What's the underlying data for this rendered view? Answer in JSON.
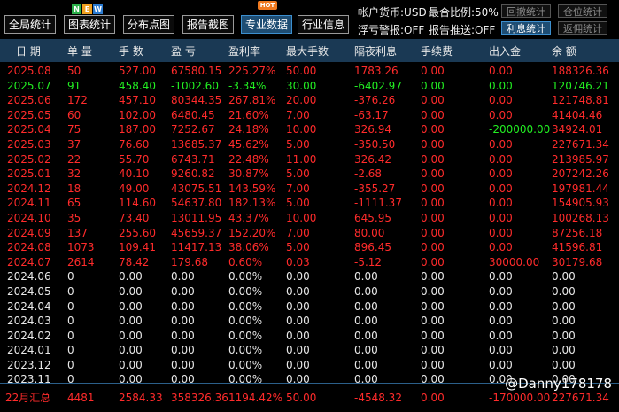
{
  "toolbar": {
    "buttons": [
      "全局统计",
      "图表统计",
      "分布点图",
      "报告截图",
      "专业数据",
      "行业信息"
    ],
    "new_badge": [
      "N",
      "E",
      "W"
    ],
    "hot_badge": "HOT"
  },
  "account": {
    "currency": "帐户货币:USD",
    "ratio": "最合比例:50%",
    "float_warning": "浮亏警报:OFF",
    "report_push": "报告推送:OFF"
  },
  "side_buttons": [
    "回撤统计",
    "仓位统计",
    "利息统计",
    "返佣统计"
  ],
  "colors": {
    "red": "#ff2b2b",
    "green": "#22ee22",
    "white": "#e8e8e8",
    "accent": "#1e4d73"
  },
  "columns": [
    "日 期",
    "单 量",
    "手 数",
    "盈 亏",
    "盈利率",
    "最大手数",
    "隔夜利息",
    "手续费",
    "出入金",
    "余 额"
  ],
  "rows": [
    {
      "c": [
        "2025.08",
        "50",
        "527.00",
        "67580.15",
        "225.27%",
        "50.00",
        "1783.26",
        "0.00",
        "0.00",
        "188326.36"
      ],
      "color": "red"
    },
    {
      "c": [
        "2025.07",
        "91",
        "458.40",
        "-1002.60",
        "-3.34%",
        "30.00",
        "-6402.97",
        "0.00",
        "0.00",
        "120746.21"
      ],
      "color": "green"
    },
    {
      "c": [
        "2025.06",
        "172",
        "457.10",
        "80344.35",
        "267.81%",
        "20.00",
        "-376.26",
        "0.00",
        "0.00",
        "121748.81"
      ],
      "color": "red"
    },
    {
      "c": [
        "2025.05",
        "60",
        "102.00",
        "6480.45",
        "21.60%",
        "7.00",
        "-63.17",
        "0.00",
        "0.00",
        "41404.46"
      ],
      "color": "red"
    },
    {
      "c": [
        "2025.04",
        "75",
        "187.00",
        "7252.67",
        "24.18%",
        "10.00",
        "326.94",
        "0.00",
        "-200000.00",
        "34924.01"
      ],
      "color": "red"
    },
    {
      "c": [
        "2025.03",
        "37",
        "76.60",
        "13685.37",
        "45.62%",
        "5.00",
        "-350.50",
        "0.00",
        "0.00",
        "227671.34"
      ],
      "color": "red"
    },
    {
      "c": [
        "2025.02",
        "22",
        "55.70",
        "6743.71",
        "22.48%",
        "11.00",
        "326.42",
        "0.00",
        "0.00",
        "213985.97"
      ],
      "color": "red"
    },
    {
      "c": [
        "2025.01",
        "32",
        "40.10",
        "9260.82",
        "30.87%",
        "5.00",
        "-2.68",
        "0.00",
        "0.00",
        "207242.26"
      ],
      "color": "red"
    },
    {
      "c": [
        "2024.12",
        "18",
        "49.00",
        "43075.51",
        "143.59%",
        "7.00",
        "-355.27",
        "0.00",
        "0.00",
        "197981.44"
      ],
      "color": "red"
    },
    {
      "c": [
        "2024.11",
        "65",
        "114.60",
        "54637.80",
        "182.13%",
        "5.00",
        "-1111.37",
        "0.00",
        "0.00",
        "154905.93"
      ],
      "color": "red"
    },
    {
      "c": [
        "2024.10",
        "35",
        "73.40",
        "13011.95",
        "43.37%",
        "10.00",
        "645.95",
        "0.00",
        "0.00",
        "100268.13"
      ],
      "color": "red"
    },
    {
      "c": [
        "2024.09",
        "137",
        "255.60",
        "45659.37",
        "152.20%",
        "7.00",
        "80.00",
        "0.00",
        "0.00",
        "87256.18"
      ],
      "color": "red"
    },
    {
      "c": [
        "2024.08",
        "1073",
        "109.41",
        "11417.13",
        "38.06%",
        "5.00",
        "896.45",
        "0.00",
        "0.00",
        "41596.81"
      ],
      "color": "red"
    },
    {
      "c": [
        "2024.07",
        "2614",
        "78.42",
        "179.68",
        "0.60%",
        "0.03",
        "-5.12",
        "0.00",
        "30000.00",
        "30179.68"
      ],
      "color": "red"
    },
    {
      "c": [
        "2024.06",
        "0",
        "0.00",
        "0.00",
        "0.00%",
        "0.00",
        "0.00",
        "0.00",
        "0.00",
        "0.00"
      ],
      "color": "white"
    },
    {
      "c": [
        "2024.05",
        "0",
        "0.00",
        "0.00",
        "0.00%",
        "0.00",
        "0.00",
        "0.00",
        "0.00",
        "0.00"
      ],
      "color": "white"
    },
    {
      "c": [
        "2024.04",
        "0",
        "0.00",
        "0.00",
        "0.00%",
        "0.00",
        "0.00",
        "0.00",
        "0.00",
        "0.00"
      ],
      "color": "white"
    },
    {
      "c": [
        "2024.03",
        "0",
        "0.00",
        "0.00",
        "0.00%",
        "0.00",
        "0.00",
        "0.00",
        "0.00",
        "0.00"
      ],
      "color": "white"
    },
    {
      "c": [
        "2024.02",
        "0",
        "0.00",
        "0.00",
        "0.00%",
        "0.00",
        "0.00",
        "0.00",
        "0.00",
        "0.00"
      ],
      "color": "white"
    },
    {
      "c": [
        "2024.01",
        "0",
        "0.00",
        "0.00",
        "0.00%",
        "0.00",
        "0.00",
        "0.00",
        "0.00",
        "0.00"
      ],
      "color": "white"
    },
    {
      "c": [
        "2023.12",
        "0",
        "0.00",
        "0.00",
        "0.00%",
        "0.00",
        "0.00",
        "0.00",
        "0.00",
        "0.00"
      ],
      "color": "white"
    },
    {
      "c": [
        "2023.11",
        "0",
        "0.00",
        "0.00",
        "0.00%",
        "0.00",
        "0.00",
        "0.00",
        "0.00",
        "0.00"
      ],
      "color": "white"
    }
  ],
  "summary": [
    "22月汇总",
    "4481",
    "2584.33",
    "358326.36",
    "1194.42%",
    "50.00",
    "-4548.32",
    "0.00",
    "-170000.00",
    "227671.34"
  ],
  "watermark": "@Danny178178"
}
